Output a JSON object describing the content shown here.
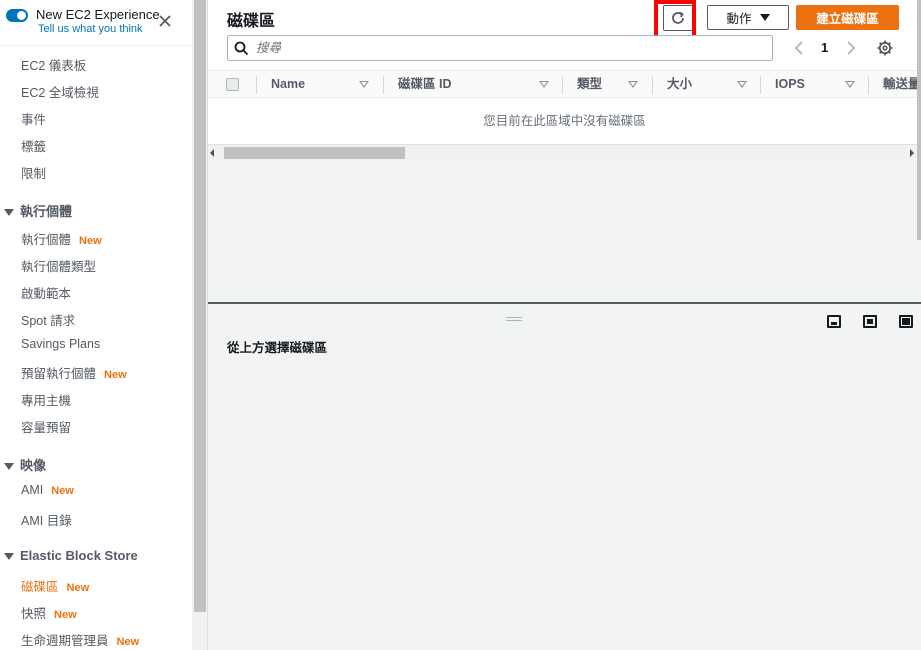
{
  "sidebar": {
    "experience_title": "New EC2 Experience",
    "feedback_link": "Tell us what you think",
    "top_items": [
      "EC2 儀表板",
      "EC2 全域檢視",
      "事件",
      "標籤",
      "限制"
    ],
    "sections": [
      {
        "title": "執行個體",
        "items": [
          {
            "label": "執行個體",
            "badge": "New"
          },
          {
            "label": "執行個體類型",
            "badge": ""
          },
          {
            "label": "啟動範本",
            "badge": ""
          },
          {
            "label": "Spot 請求",
            "badge": ""
          },
          {
            "label": "Savings Plans",
            "badge": ""
          },
          {
            "label": "預留執行個體",
            "badge": "New"
          },
          {
            "label": "專用主機",
            "badge": ""
          },
          {
            "label": "容量預留",
            "badge": ""
          }
        ]
      },
      {
        "title": "映像",
        "items": [
          {
            "label": "AMI",
            "badge": "New"
          },
          {
            "label": "AMI 目錄",
            "badge": ""
          }
        ]
      },
      {
        "title": "Elastic Block Store",
        "items": [
          {
            "label": "磁碟區",
            "badge": "New",
            "active": true
          },
          {
            "label": "快照",
            "badge": "New"
          },
          {
            "label": "生命週期管理員",
            "badge": "New"
          }
        ]
      }
    ]
  },
  "main": {
    "title": "磁碟區",
    "actions_label": "動作",
    "create_label": "建立磁碟區",
    "search_placeholder": "搜尋",
    "page_number": "1",
    "columns": [
      "Name",
      "磁碟區 ID",
      "類型",
      "大小",
      "IOPS",
      "輸送量"
    ],
    "empty_message": "您目前在此區域中沒有磁碟區",
    "details_message": "從上方選擇磁碟區"
  },
  "colors": {
    "accent": "#ec7211",
    "link": "#0073bb",
    "highlight": "#ff0000"
  }
}
